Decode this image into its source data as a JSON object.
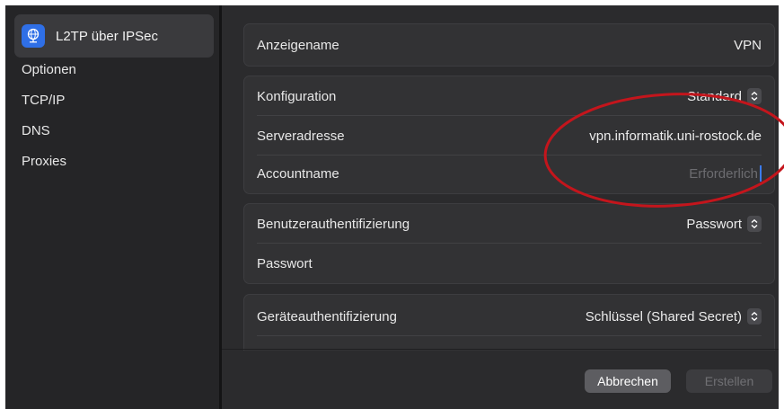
{
  "sidebar": {
    "selected": {
      "label": "L2TP über IPSec",
      "icon": "globe-network-icon"
    },
    "items": [
      {
        "label": "Optionen"
      },
      {
        "label": "TCP/IP"
      },
      {
        "label": "DNS"
      },
      {
        "label": "Proxies"
      }
    ]
  },
  "fields": {
    "anzeigename": {
      "label": "Anzeigename",
      "value": "VPN"
    },
    "konfiguration": {
      "label": "Konfiguration",
      "value": "Standard"
    },
    "serveradresse": {
      "label": "Serveradresse",
      "value": "vpn.informatik.uni-rostock.de"
    },
    "accountname": {
      "label": "Accountname",
      "placeholder": "Erforderlich"
    },
    "benutzerauth": {
      "label": "Benutzerauthentifizierung",
      "value": "Passwort"
    },
    "passwort": {
      "label": "Passwort"
    },
    "geraeteauth": {
      "label": "Geräteauthentifizierung",
      "value": "Schlüssel (Shared Secret)"
    }
  },
  "buttons": {
    "cancel": "Abbrechen",
    "create": "Erstellen"
  },
  "colors": {
    "accent": "#2f6fe6",
    "annotation": "#c4151c"
  }
}
